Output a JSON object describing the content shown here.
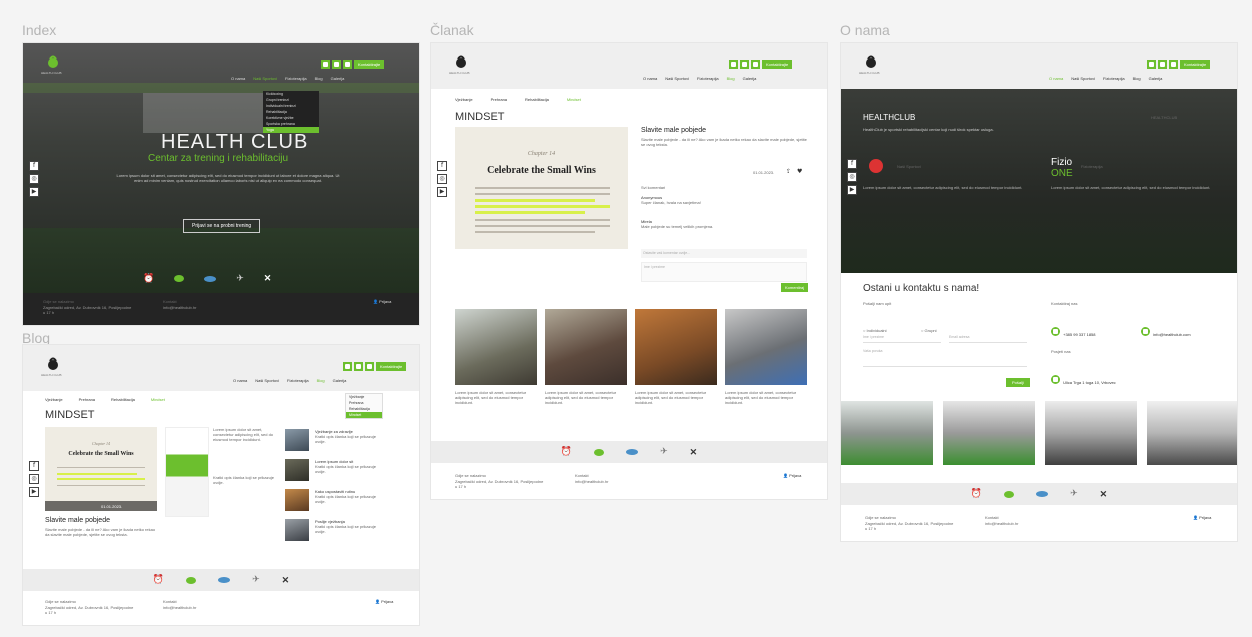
{
  "boards": {
    "index": "Index",
    "clanak": "Članak",
    "onama": "O nama",
    "blog": "Blog"
  },
  "logo": {
    "text": "HEALTH CLUB"
  },
  "contact_btn": "Kontaktirajte",
  "nav": {
    "items": [
      "O nama",
      "Naši Sportovi",
      "Fizioterapija",
      "Blog",
      "Galerija"
    ]
  },
  "index": {
    "hero_title": "HEALTH CLUB",
    "hero_sub": "Centar za trening i rehabilitaciju",
    "hero_desc": "Lorem ipsum dolor sit amet, consectetur adipiscing elit, sed do eiusmod tempor incididunt ut labore et dolore magna aliqua. Ut enim ad minim veniam, quis nostrud exercitation ullamco laboris nisi ut aliquip ex ea commodo consequat.",
    "cta": "Prijavi se na probni trening",
    "dropdown": [
      "Kickboxing",
      "Grupni treninzi",
      "Individualni treninzi",
      "Rehabilitacija",
      "Korektivne vježbe",
      "Sportska prehrana",
      "Yoga"
    ],
    "footer_col1_title": "Gdje se nalazimo",
    "footer_col1_text": "Zagrebački odred, Av. Dubrovnik 16, Poslijepodne u 17 h",
    "footer_col2_title": "Kontakt",
    "footer_col2_text": "info@healthclub.hr",
    "login": "Prijava"
  },
  "clanak": {
    "tabs": [
      "Vježbanje",
      "Prehrana",
      "Rehabilitacija",
      "Mindset"
    ],
    "heading": "MINDSET",
    "book_chapter": "Chapter 14",
    "book_title": "Celebrate the Small Wins",
    "post_title": "Slavite male pobjede",
    "post_text": "Slavite male pobjede - da ili ne? Ako vam je ikada netko rekao da slavite male pobjede, sjetite se ovog teksta.",
    "post_date": "01.01.2023.",
    "comments_title": "Svi komentari",
    "comment1_author": "Anonymous",
    "comment1_text": "Super članak, hvala na savjetima!",
    "comment2_author": "Mirela",
    "comment2_text": "Male pobjede su temelj velikih promjena.",
    "comment_placeholder": "Ostavite vaš komentar ovdje...",
    "name_placeholder": "Ime i prezime",
    "submit": "Komentiraj",
    "gallery_caption": "Lorem ipsum dolor sit amet, consectetur adipiscing elit, sed do eiusmod tempor incididunt."
  },
  "onama": {
    "title": "HEALTHCLUB",
    "desc": "HealthClub je sportski rehabilitacijski centar koji nudi širok spektar usluga.",
    "block1": "Naši Sportovi",
    "block2_a": "Fizio",
    "block2_b": "ONE",
    "block2_label": "Fizioterapija",
    "contact_heading": "Ostani u kontaktu s nama!",
    "form_title": "Pošalji nam upit",
    "radio1": "Individualni",
    "radio2": "Grupni",
    "field1": "Ime i prezime",
    "field2": "Email adresa",
    "field3": "Vaša poruka",
    "send": "Pošalji",
    "phone": "+385 99 337 1858",
    "email": "info@healthclub.com",
    "address": "Ulica Trga 1 toga 10, Vrbovec",
    "address_title": "Posjeti nas",
    "contact_title": "Kontaktiraj nas"
  },
  "blog": {
    "heading": "MINDSET",
    "post_title": "Slavite male pobjede",
    "post_text": "Slavite male pobjede - da ili ne? Ako vam je ikada netko rekao da slavite male pobjede, sjetite se ovog teksta.",
    "side1_title": "Vježbanje za zdravlje",
    "side2_title": "Lorem ipsum dolor sit",
    "side3_title": "Kako uspostaviti rutinu",
    "side4_title": "Poslije vježbanja",
    "side_text": "Kratki opis članka koji se prikazuje ovdje."
  },
  "colors": {
    "accent": "#6cbf2e",
    "dark": "#2a2a2a"
  }
}
